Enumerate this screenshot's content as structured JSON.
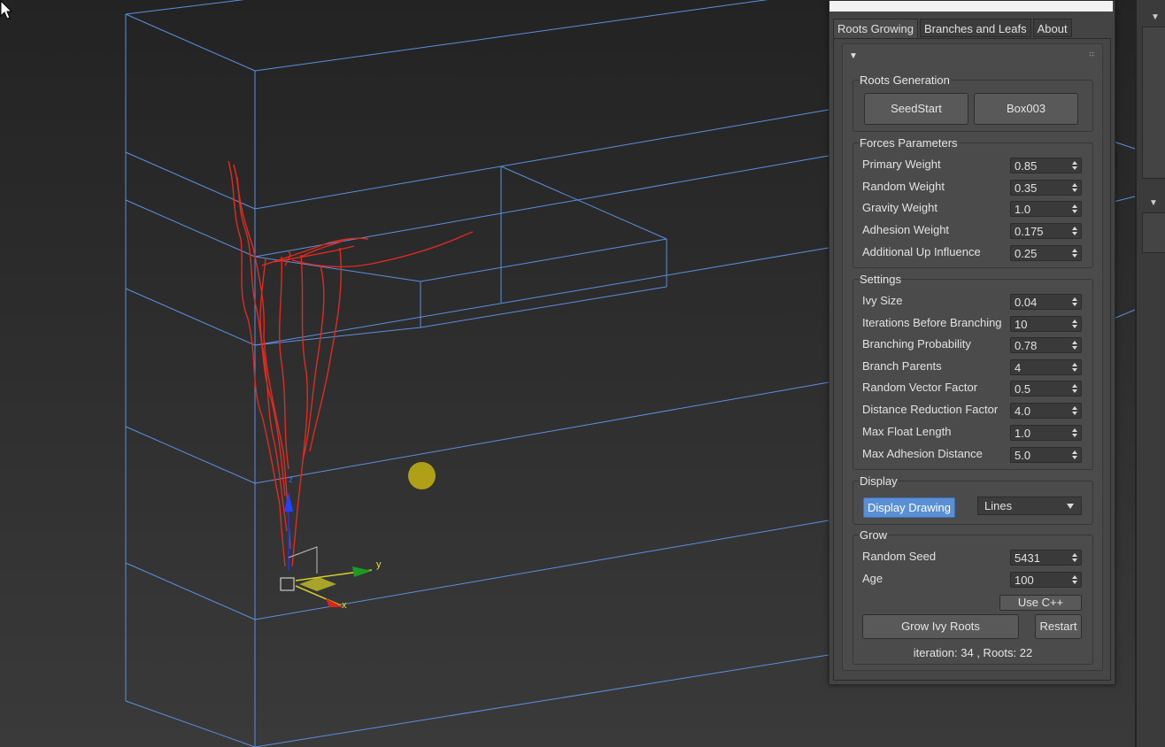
{
  "tabs": [
    {
      "label": "Roots Growing",
      "active": true
    },
    {
      "label": "Branches and Leafs",
      "active": false
    },
    {
      "label": "About",
      "active": false
    }
  ],
  "roots_generation": {
    "title": "Roots Generation",
    "seed_button": "SeedStart",
    "target_button": "Box003"
  },
  "forces": {
    "title": "Forces Parameters",
    "params": [
      {
        "label": "Primary Weight",
        "value": "0.85"
      },
      {
        "label": "Random Weight",
        "value": "0.35"
      },
      {
        "label": "Gravity Weight",
        "value": "1.0"
      },
      {
        "label": "Adhesion Weight",
        "value": "0.175"
      },
      {
        "label": "Additional Up Influence",
        "value": "0.25"
      }
    ]
  },
  "settings": {
    "title": "Settings",
    "params": [
      {
        "label": "Ivy Size",
        "value": "0.04"
      },
      {
        "label": "Iterations Before Branching",
        "value": "10"
      },
      {
        "label": "Branching Probability",
        "value": "0.78"
      },
      {
        "label": "Branch Parents",
        "value": "4"
      },
      {
        "label": "Random Vector Factor",
        "value": "0.5"
      },
      {
        "label": "Distance Reduction Factor",
        "value": "4.0"
      },
      {
        "label": "Max Float Length",
        "value": "1.0"
      },
      {
        "label": "Max Adhesion Distance",
        "value": "5.0"
      }
    ]
  },
  "display": {
    "title": "Display",
    "toggle_label": "Display Drawing",
    "toggle_on": true,
    "mode_selected": "Lines"
  },
  "grow": {
    "title": "Grow",
    "params": [
      {
        "label": "Random Seed",
        "value": "5431"
      },
      {
        "label": "Age",
        "value": "100"
      }
    ],
    "use_cpp_label": "Use C++",
    "grow_button": "Grow Ivy Roots",
    "restart_button": "Restart",
    "status": "iteration: 34 , Roots: 22"
  },
  "gizmo": {
    "axis_x": "x",
    "axis_y": "y",
    "axis_z": "z"
  },
  "colors": {
    "wireframe": "#5b8fe0",
    "ivy": "#e02b20",
    "accent_button": "#5a8fd6",
    "cursor_highlight": "#bcac14"
  }
}
